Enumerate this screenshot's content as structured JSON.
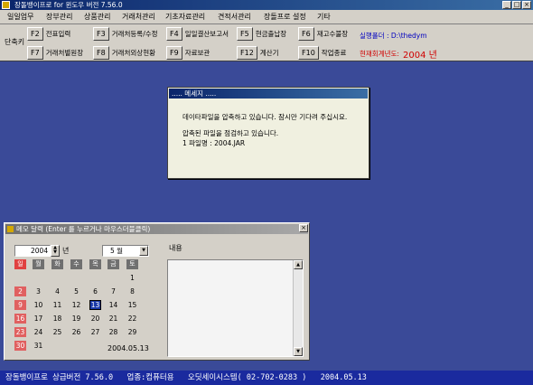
{
  "window": {
    "title": "장돌뱅이프로 for 윈도우 버전 7.56.0",
    "minimize_glyph": "_",
    "maximize_glyph": "□",
    "close_glyph": "×"
  },
  "menu": {
    "items": [
      "일일업무",
      "장부관리",
      "상품관리",
      "거래처관리",
      "기초자료관리",
      "견적서관리",
      "장돌프로 설정",
      "기타"
    ]
  },
  "toolbar": {
    "shortcut_label": "단축키",
    "buttons": [
      {
        "key": "F2",
        "label": "전표입력"
      },
      {
        "key": "F3",
        "label": "거래처등록/수정"
      },
      {
        "key": "F4",
        "label": "일일결산보고서"
      },
      {
        "key": "F5",
        "label": "현금출납장"
      },
      {
        "key": "F6",
        "label": "재고수불장"
      },
      {
        "key": "F7",
        "label": "거래처별원장"
      },
      {
        "key": "F8",
        "label": "거래처외상현황"
      },
      {
        "key": "F9",
        "label": "자료보관"
      },
      {
        "key": "F12",
        "label": "계산기"
      },
      {
        "key": "F10",
        "label": "작업종료"
      }
    ],
    "exec_folder": "실행폴더 : D:\\thedym",
    "fiscal_year_label": "현재회계년도:",
    "fiscal_year_value": "2004 년"
  },
  "dialog": {
    "title": "..... 메세지 .....",
    "line1": "데이타파일을 압축하고 있습니다. 잠시만 기다려 주십시요.",
    "line2": "압축된 파일을 점검하고 있습니다.",
    "line3": "1 파일명  : 2004.JAR"
  },
  "memo": {
    "title": "메모 달력 (Enter 를 누르거나 마우스더블클릭)",
    "close_glyph": "×",
    "year_value": "2004",
    "year_unit": "년",
    "month_value": "5 월",
    "weekdays": [
      "일",
      "월",
      "화",
      "수",
      "목",
      "금",
      "토"
    ],
    "days": [
      "1",
      "2",
      "3",
      "4",
      "5",
      "6",
      "7",
      "8",
      "9",
      "10",
      "11",
      "12",
      "13",
      "14",
      "15",
      "16",
      "17",
      "18",
      "19",
      "20",
      "21",
      "22",
      "23",
      "24",
      "25",
      "26",
      "27",
      "28",
      "29",
      "30",
      "31"
    ],
    "selected_date": "2004.05.13",
    "content_label": "내용",
    "memo_text": ""
  },
  "status": {
    "text": "장돌뱅이프로 상급버전 7.56.0   업종:컴퓨터용   오딧세이시스템( 02-702-0283 )   2004.05.13"
  },
  "colors": {
    "desktop": "#3a4a98",
    "titlebar": "#0a246a",
    "statusbar": "#1a2a9e",
    "exec_folder": "#0000c0",
    "fiscal_year": "#d00000",
    "sunday": "#e04040",
    "today": "#1a3aa8"
  }
}
